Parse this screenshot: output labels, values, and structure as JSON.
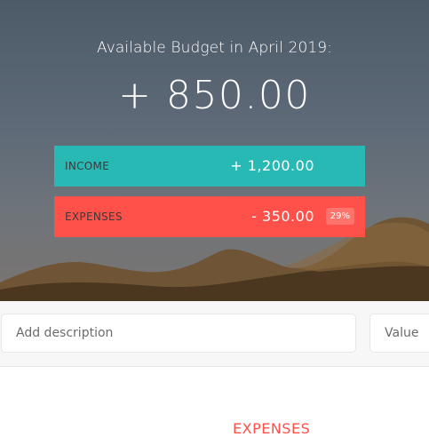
{
  "header": {
    "title": "Available Budget in April 2019:",
    "total": "+ 850.00"
  },
  "income": {
    "label": "INCOME",
    "amount": "+ 1,200.00",
    "color": "#28b9b5"
  },
  "expenses": {
    "label": "EXPENSES",
    "amount": "- 350.00",
    "percentage": "29%",
    "color": "#ff5049"
  },
  "add": {
    "description_placeholder": "Add description",
    "value_placeholder": "Value"
  },
  "lists": {
    "expenses_title": "EXPENSES"
  }
}
